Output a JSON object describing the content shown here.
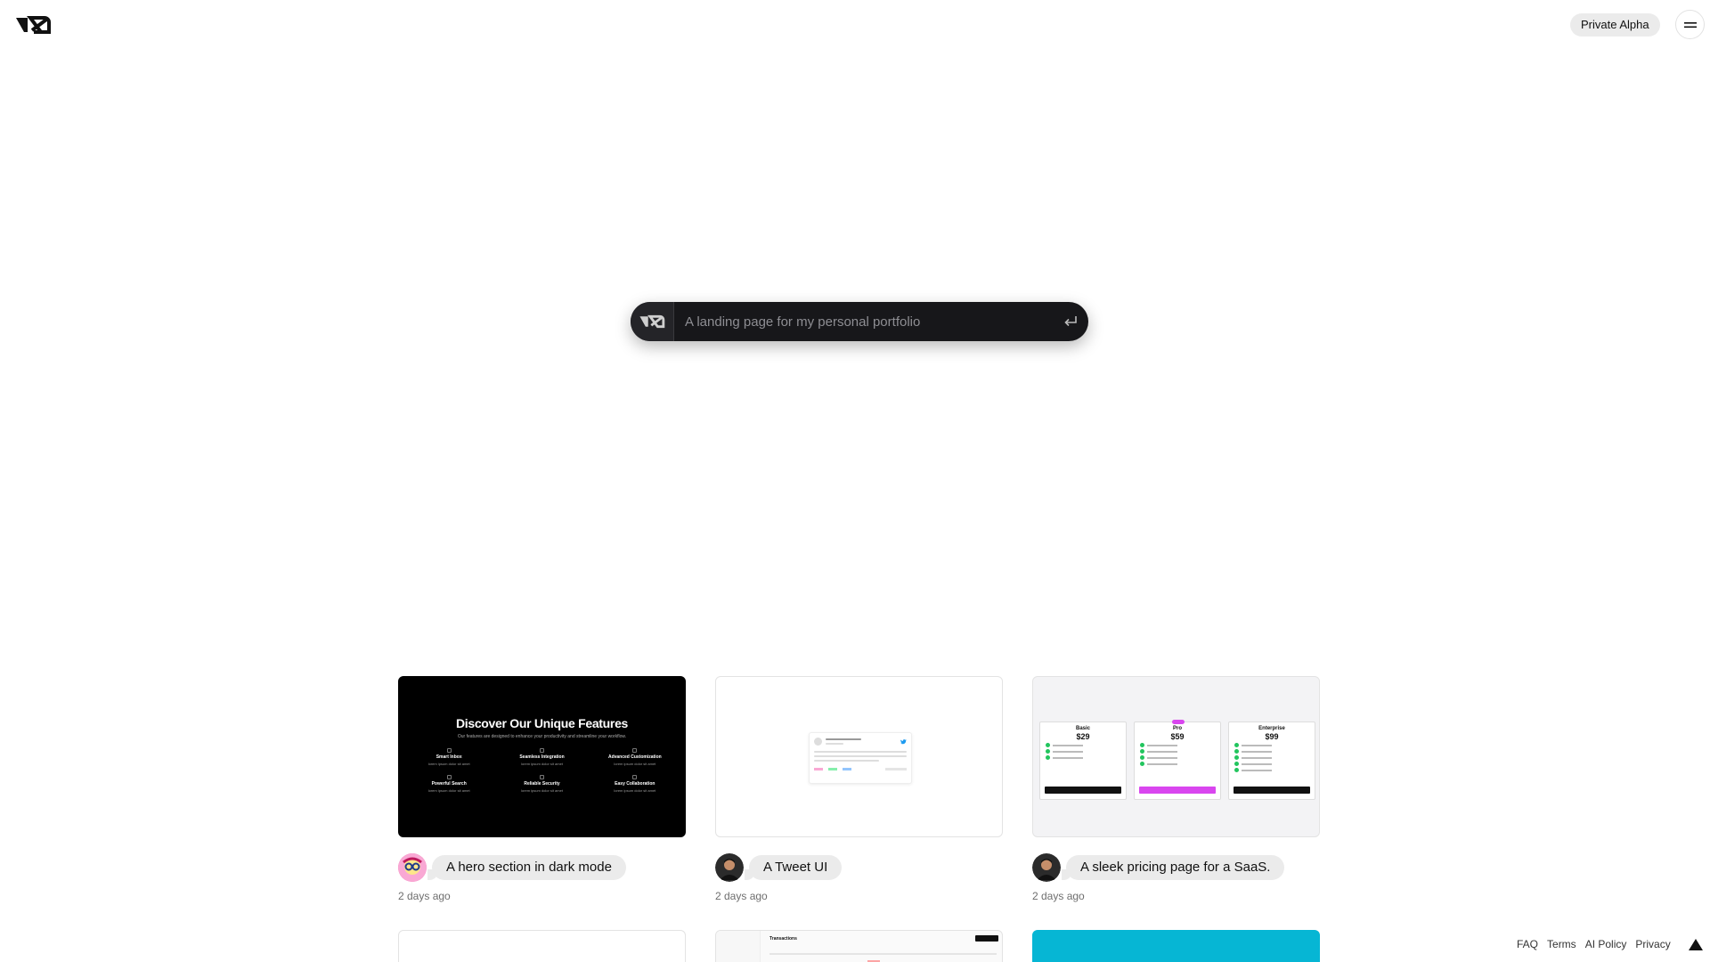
{
  "header": {
    "logo_text": "v0",
    "badge": "Private Alpha"
  },
  "prompt": {
    "placeholder": "A landing page for my personal portfolio"
  },
  "gallery": [
    {
      "title": "A hero section in dark mode",
      "time": "2 days ago",
      "preview": {
        "heading": "Discover Our Unique Features",
        "subheading": "Our features are designed to enhance your productivity and streamline your workflow.",
        "features": [
          "Smart Inbox",
          "Seamless Integration",
          "Advanced Customization",
          "Powerful Search",
          "Reliable Security",
          "Easy Collaboration"
        ]
      }
    },
    {
      "title": "A Tweet UI",
      "time": "2 days ago"
    },
    {
      "title": "A sleek pricing page for a SaaS.",
      "time": "2 days ago",
      "preview": {
        "plans": [
          {
            "name": "Basic",
            "price": "$29"
          },
          {
            "name": "Pro",
            "price": "$59"
          },
          {
            "name": "Enterprise",
            "price": "$99"
          }
        ]
      }
    }
  ],
  "bottom_row": {
    "transactions_title": "Transactions"
  },
  "footer": {
    "links": [
      "FAQ",
      "Terms",
      "AI Policy",
      "Privacy"
    ]
  },
  "colors": {
    "prompt_bg": "#17171a",
    "badge_bg": "#ebebeb",
    "accent_cyan": "#06b6d4",
    "pricing_pro": "#d946ef"
  }
}
